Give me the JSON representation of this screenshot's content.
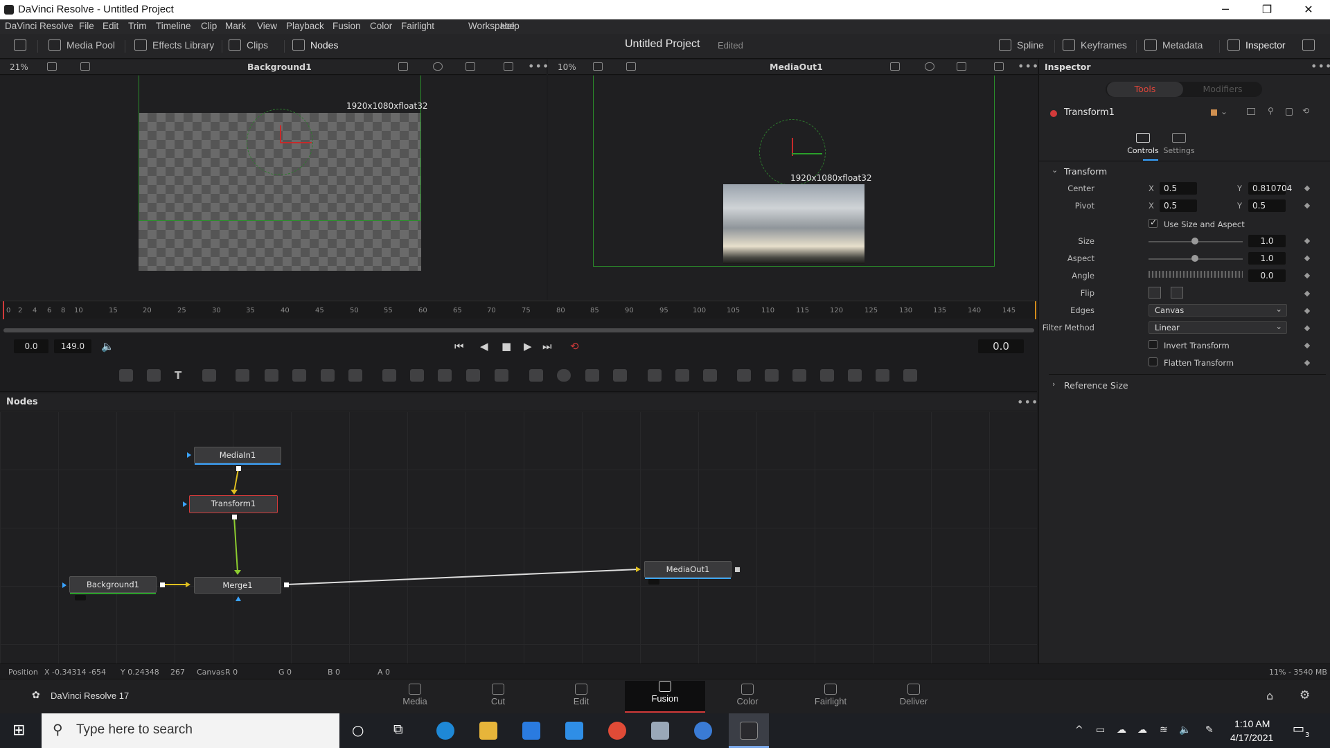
{
  "window": {
    "title": "DaVinci Resolve - Untitled Project",
    "minimize": "─",
    "restore": "❐",
    "close": "✕"
  },
  "menu": [
    "DaVinci Resolve",
    "File",
    "Edit",
    "Trim",
    "Timeline",
    "Clip",
    "Mark",
    "View",
    "Playback",
    "Fusion",
    "Color",
    "Fairlight",
    "Workspace",
    "Help"
  ],
  "toolbar": {
    "media_pool": "Media Pool",
    "effects_library": "Effects Library",
    "clips": "Clips",
    "nodes": "Nodes",
    "project_title": "Untitled Project",
    "edited": "Edited",
    "spline": "Spline",
    "keyframes": "Keyframes",
    "metadata": "Metadata",
    "inspector": "Inspector"
  },
  "viewer_left": {
    "zoom": "21%",
    "name": "Background1",
    "resolution": "1920x1080xfloat32"
  },
  "viewer_right": {
    "zoom": "10%",
    "name": "MediaOut1",
    "resolution": "1920x1080xfloat32"
  },
  "ruler": {
    "ticks": [
      "0",
      "2",
      "4",
      "6",
      "8",
      "10",
      "15",
      "20",
      "25",
      "30",
      "35",
      "40",
      "45",
      "50",
      "55",
      "60",
      "65",
      "70",
      "75",
      "80",
      "85",
      "90",
      "95",
      "100",
      "105",
      "110",
      "115",
      "120",
      "125",
      "130",
      "135",
      "140",
      "145"
    ]
  },
  "transport": {
    "start": "0.0",
    "end": "149.0",
    "current": "0.0"
  },
  "nodes_panel": {
    "title": "Nodes",
    "nodes": [
      {
        "name": "MediaIn1"
      },
      {
        "name": "Transform1"
      },
      {
        "name": "Background1"
      },
      {
        "name": "Merge1"
      },
      {
        "name": "MediaOut1"
      }
    ]
  },
  "status": {
    "position_label": "Position",
    "x": "X -0.34314",
    "px": "-654",
    "y": "Y 0.24348",
    "py": "267",
    "canvas": "Canvas",
    "r": "R 0",
    "g": "G 0",
    "b": "B 0",
    "a": "A 0",
    "memory": "11% - 3540 MB"
  },
  "app_name": "DaVinci Resolve 17",
  "pages": [
    {
      "label": "Media"
    },
    {
      "label": "Cut"
    },
    {
      "label": "Edit"
    },
    {
      "label": "Fusion",
      "active": true
    },
    {
      "label": "Color"
    },
    {
      "label": "Fairlight"
    },
    {
      "label": "Deliver"
    }
  ],
  "inspector": {
    "title": "Inspector",
    "tabs": {
      "tools": "Tools",
      "modifiers": "Modifiers"
    },
    "tool_name": "Transform1",
    "subtabs": {
      "controls": "Controls",
      "settings": "Settings"
    },
    "section_transform": "Transform",
    "center_label": "Center",
    "center_x": "0.5",
    "center_y": "0.810704",
    "pivot_label": "Pivot",
    "pivot_x": "0.5",
    "pivot_y": "0.5",
    "x": "X",
    "y": "Y",
    "use_size_aspect": "Use Size and Aspect",
    "size_label": "Size",
    "size_value": "1.0",
    "aspect_label": "Aspect",
    "aspect_value": "1.0",
    "angle_label": "Angle",
    "angle_value": "0.0",
    "flip_label": "Flip",
    "edges_label": "Edges",
    "edges_value": "Canvas",
    "filter_label": "Filter Method",
    "filter_value": "Linear",
    "invert_transform": "Invert Transform",
    "flatten_transform": "Flatten Transform",
    "section_reference": "Reference Size"
  },
  "taskbar": {
    "search_placeholder": "Type here to search",
    "time": "1:10 AM",
    "date": "4/17/2021",
    "notifications": "3"
  },
  "colors": {
    "accent_red": "#d23a3a",
    "selection_blue": "#3aa3ff",
    "wire_yellow": "#e0c020",
    "wire_green": "#8ccc30"
  }
}
